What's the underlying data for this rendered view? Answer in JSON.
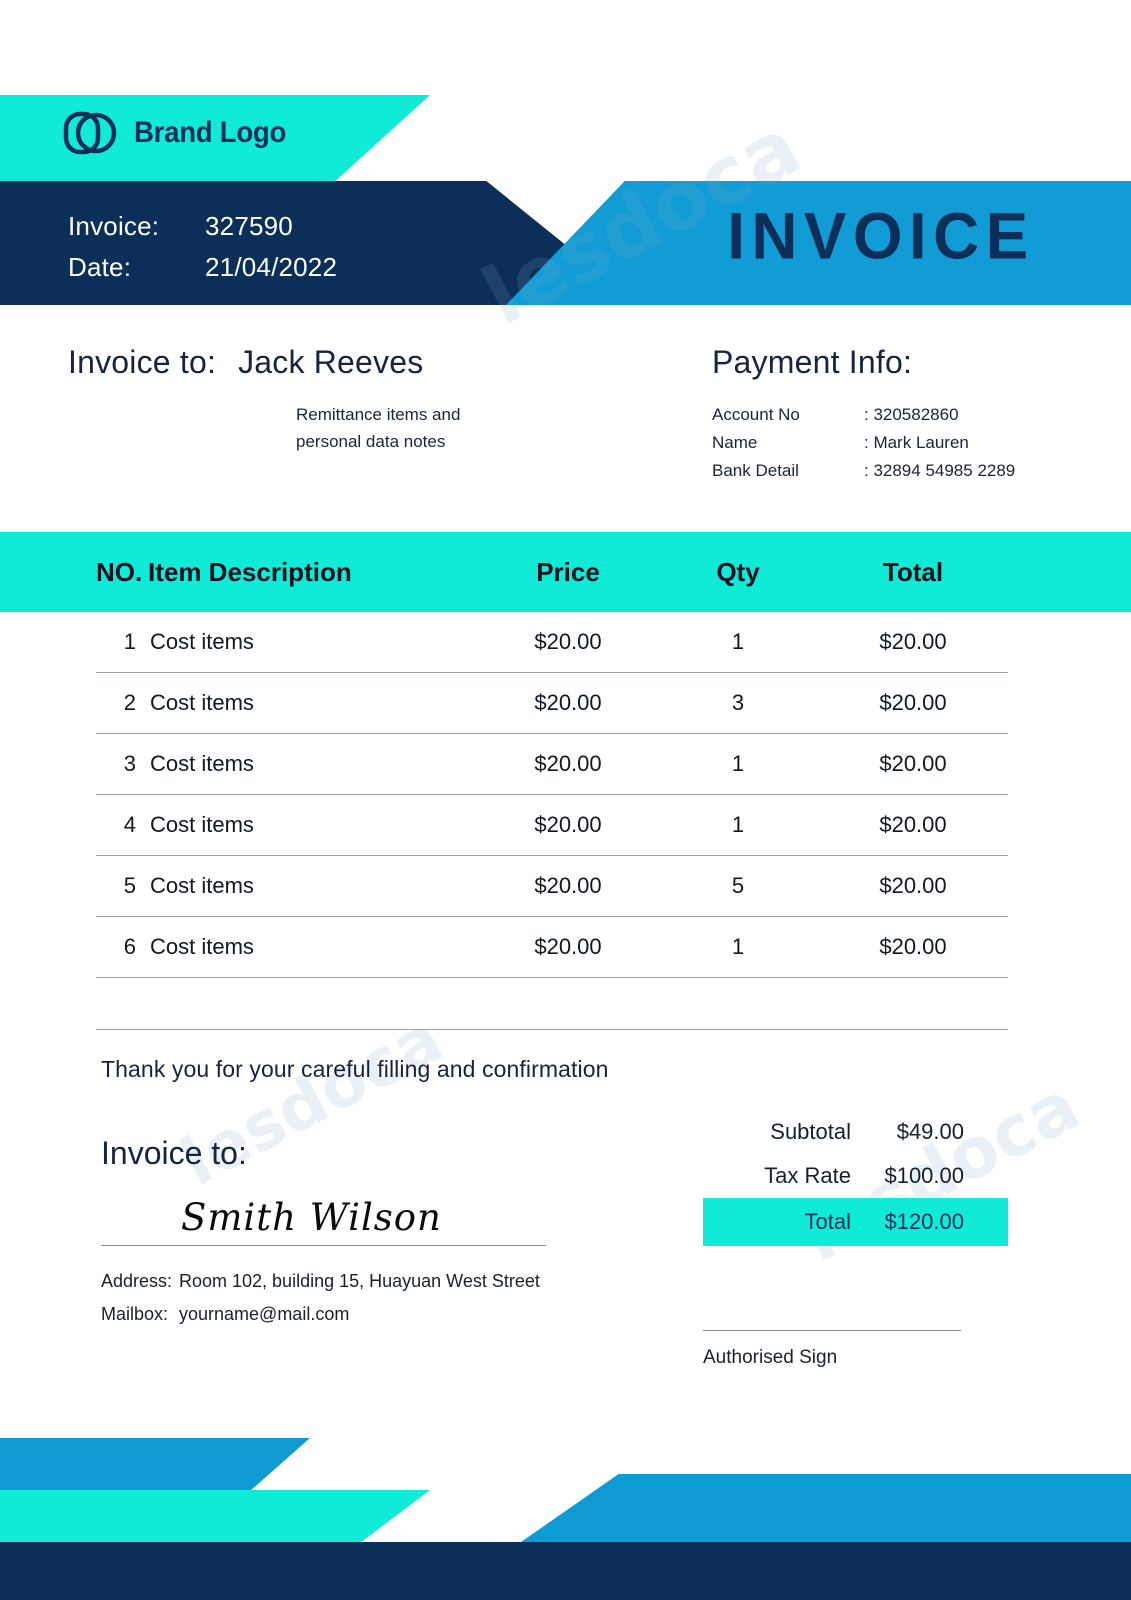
{
  "brand": {
    "logo_icon": "overlapping-circles-logo",
    "name": "Brand Logo"
  },
  "header": {
    "invoice_label": "Invoice:",
    "invoice_number": "327590",
    "date_label": "Date:",
    "date_value": "21/04/2022",
    "title": "INVOICE"
  },
  "bill_to": {
    "label": "Invoice to:",
    "name": "Jack Reeves",
    "note_line1": "Remittance items and",
    "note_line2": "personal data notes"
  },
  "payment_info": {
    "heading": "Payment Info:",
    "rows": [
      {
        "key": "Account No",
        "value": ": 320582860"
      },
      {
        "key": "Name",
        "value": ": Mark Lauren"
      },
      {
        "key": "Bank Detail",
        "value": ": 32894 54985 2289"
      }
    ]
  },
  "items_table": {
    "columns": {
      "no": "NO.",
      "description": "Item Description",
      "price": "Price",
      "qty": "Qty",
      "total": "Total"
    },
    "rows": [
      {
        "no": "1",
        "description": "Cost items",
        "price": "$20.00",
        "qty": "1",
        "total": "$20.00"
      },
      {
        "no": "2",
        "description": "Cost items",
        "price": "$20.00",
        "qty": "3",
        "total": "$20.00"
      },
      {
        "no": "3",
        "description": "Cost items",
        "price": "$20.00",
        "qty": "1",
        "total": "$20.00"
      },
      {
        "no": "4",
        "description": "Cost items",
        "price": "$20.00",
        "qty": "1",
        "total": "$20.00"
      },
      {
        "no": "5",
        "description": "Cost items",
        "price": "$20.00",
        "qty": "5",
        "total": "$20.00"
      },
      {
        "no": "6",
        "description": "Cost items",
        "price": "$20.00",
        "qty": "1",
        "total": "$20.00"
      }
    ]
  },
  "thanks_note": "Thank you for your careful filling and confirmation",
  "signature_block": {
    "heading": "Invoice to:",
    "signature": "Smith Wilson",
    "address_label": "Address:",
    "address_value": "Room 102, building 15, Huayuan West Street",
    "mailbox_label": "Mailbox:",
    "mailbox_value": "yourname@mail.com"
  },
  "totals": {
    "subtotal_label": "Subtotal",
    "subtotal_value": "$49.00",
    "tax_label": "Tax Rate",
    "tax_value": "$100.00",
    "total_label": "Total",
    "total_value": "$120.00"
  },
  "authorised": {
    "label": "Authorised Sign"
  },
  "watermark": {
    "text": "lesdoca"
  },
  "colors": {
    "teal": "#0FEBD6",
    "navy": "#0C2F5A",
    "blue": "#129CD5",
    "text_dark": "#18243F",
    "rule": "#9ba0a6"
  }
}
